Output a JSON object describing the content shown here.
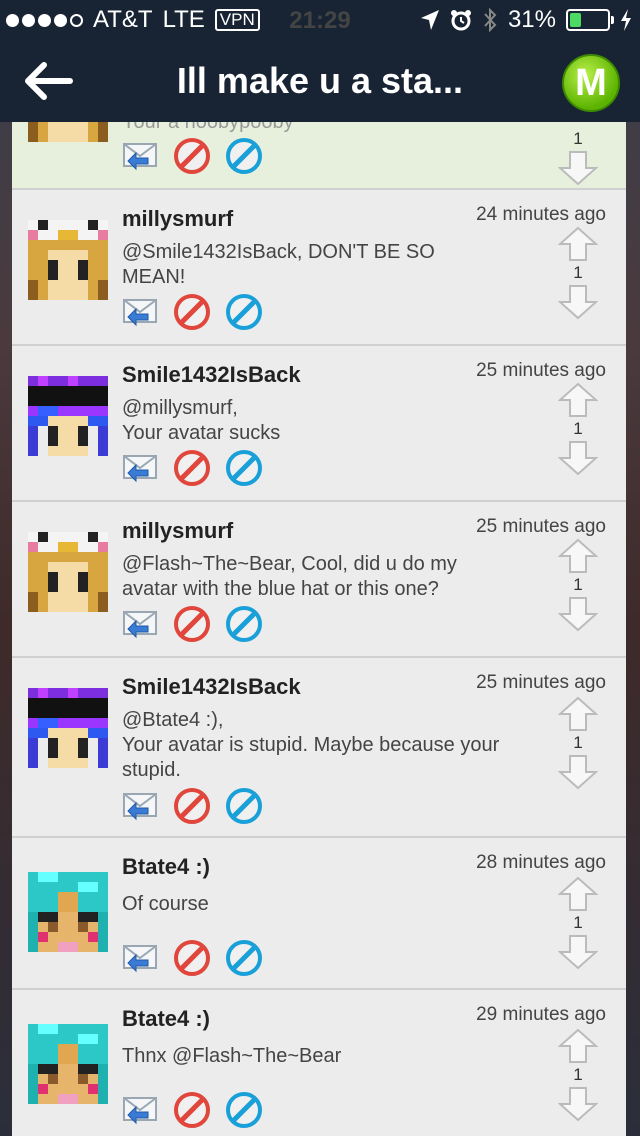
{
  "status": {
    "carrier": "AT&T",
    "network": "LTE",
    "vpn": "VPN",
    "time": "21:29",
    "battery": "31%",
    "battery_level": 0.31
  },
  "nav": {
    "title": "Ill make u a sta...",
    "logo": "M",
    "back_icon": "back-arrow-icon"
  },
  "icons": [
    "reply-icon",
    "report-icon",
    "block-icon",
    "upvote-icon",
    "downvote-icon"
  ],
  "posts": [
    {
      "user": "",
      "time": "",
      "message": "Your a noobypooby",
      "score": "1"
    },
    {
      "user": "millysmurf",
      "time": "24 minutes ago",
      "message": "@Smile1432IsBack, DON'T BE SO MEAN!",
      "score": "1"
    },
    {
      "user": "Smile1432IsBack",
      "time": "25 minutes ago",
      "message": "@millysmurf,\nYour avatar sucks",
      "score": "1"
    },
    {
      "user": "millysmurf",
      "time": "25 minutes ago",
      "message": "@Flash~The~Bear, Cool, did u do my avatar with the blue hat or this one?",
      "score": "1"
    },
    {
      "user": "Smile1432IsBack",
      "time": "25 minutes ago",
      "message": "@Btate4 :),\nYour avatar is stupid. Maybe because your stupid.",
      "score": "1"
    },
    {
      "user": "Btate4 :)",
      "time": "28 minutes ago",
      "message": "Of course",
      "score": "1"
    },
    {
      "user": "Btate4 :)",
      "time": "29 minutes ago",
      "message": "Thnx @Flash~The~Bear",
      "score": "1"
    }
  ]
}
